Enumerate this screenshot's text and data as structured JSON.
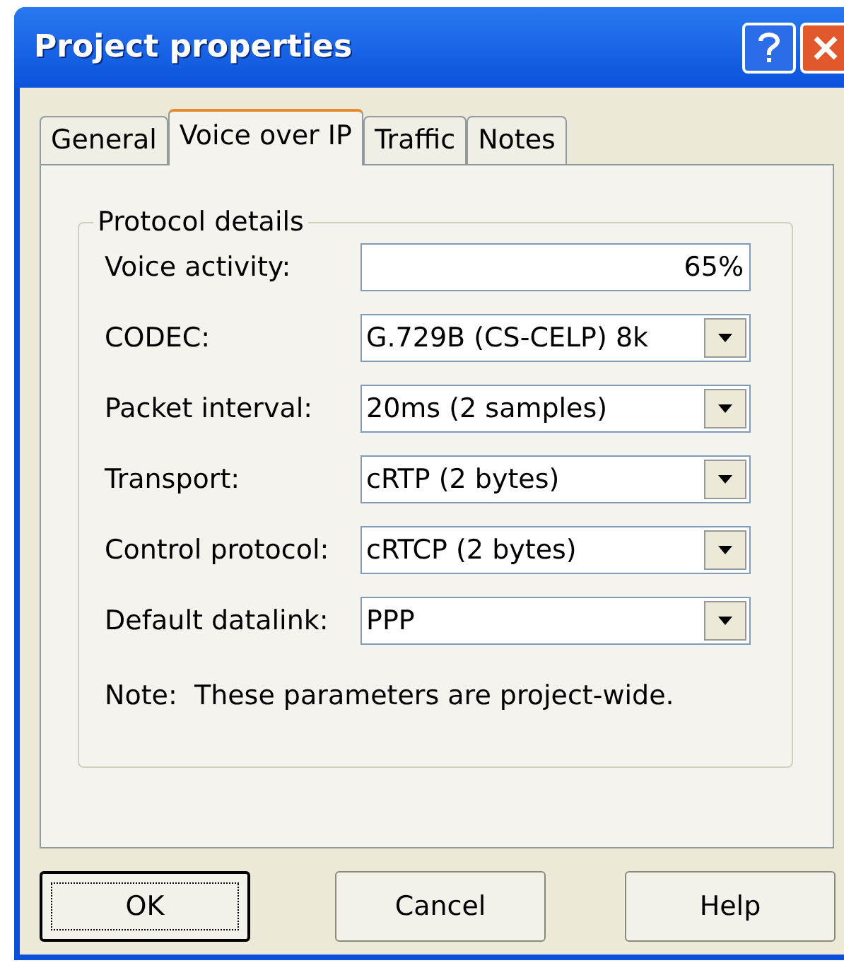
{
  "window": {
    "title": "Project properties"
  },
  "tabs": [
    {
      "label": "General",
      "selected": false
    },
    {
      "label": "Voice over IP",
      "selected": true
    },
    {
      "label": "Traffic",
      "selected": false
    },
    {
      "label": "Notes",
      "selected": false
    }
  ],
  "group": {
    "title": "Protocol details"
  },
  "fields": [
    {
      "kind": "text",
      "label": "Voice activity:",
      "value": "65%"
    },
    {
      "kind": "dropdown",
      "label": "CODEC:",
      "value": "G.729B (CS-CELP) 8k"
    },
    {
      "kind": "dropdown",
      "label": "Packet interval:",
      "value": "20ms (2 samples)"
    },
    {
      "kind": "dropdown",
      "label": "Transport:",
      "value": "cRTP (2 bytes)"
    },
    {
      "kind": "dropdown",
      "label": "Control protocol:",
      "value": "cRTCP (2 bytes)"
    },
    {
      "kind": "dropdown",
      "label": "Default datalink:",
      "value": "PPP"
    }
  ],
  "note": "Note:  These parameters are project-wide.",
  "buttons": [
    {
      "label": "OK",
      "selected": true
    },
    {
      "label": "Cancel",
      "selected": false
    },
    {
      "label": "Help",
      "selected": false
    }
  ]
}
